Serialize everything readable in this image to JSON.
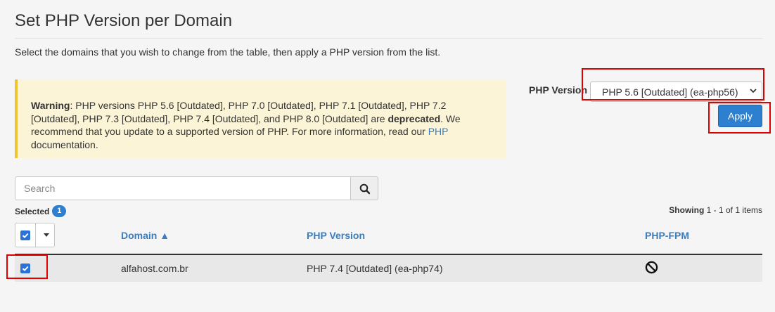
{
  "page": {
    "title": "Set PHP Version per Domain",
    "intro": "Select the domains that you wish to change from the table, then apply a PHP version from the list."
  },
  "warning": {
    "label": "Warning",
    "text1": ": PHP versions PHP 5.6 [Outdated], PHP 7.0 [Outdated], PHP 7.1 [Outdated], PHP 7.2 [Outdated], PHP 7.3 [Outdated], PHP 7.4 [Outdated], and PHP 8.0 [Outdated] are ",
    "emphasis": "deprecated",
    "text2": ". We recommend that you update to a supported version of PHP. For more information, read our ",
    "link": "PHP",
    "text3": " documentation."
  },
  "php_select": {
    "label": "PHP Version",
    "selected": "PHP 5.6 [Outdated] (ea-php56)"
  },
  "apply_button": {
    "label": "Apply"
  },
  "search": {
    "placeholder": "Search",
    "icon": "search-icon"
  },
  "selection": {
    "label": "Selected",
    "count": "1"
  },
  "pagination": {
    "prefix": "Showing",
    "range": " 1 - 1 of 1 items"
  },
  "table": {
    "columns": {
      "domain": "Domain ▲",
      "php_version": "PHP Version",
      "php_fpm": "PHP-FPM"
    },
    "rows": [
      {
        "domain": "alfahost.com.br",
        "php_version": "PHP 7.4 [Outdated] (ea-php74)",
        "php_fpm_icon": "disabled-icon",
        "checked": true
      }
    ]
  },
  "colors": {
    "accent": "#2d7fd0",
    "link": "#3a7ebf",
    "warning_bg": "#fcf4d6",
    "warning_border": "#f0c330",
    "highlight": "#e00000"
  }
}
